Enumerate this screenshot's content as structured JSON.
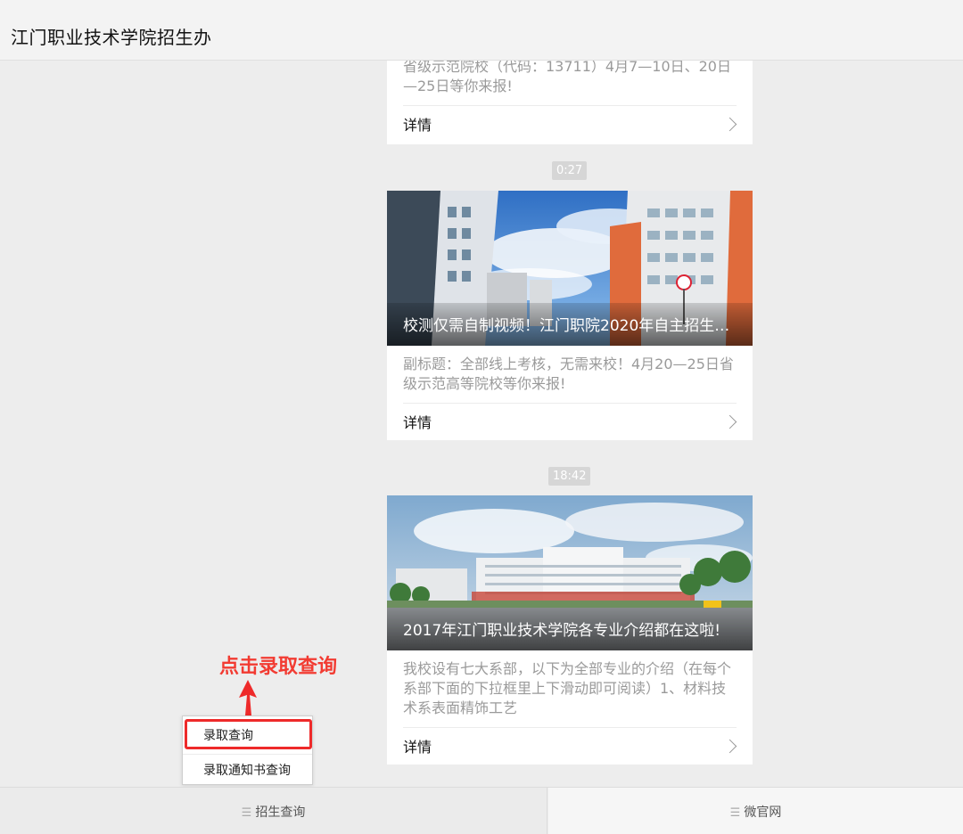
{
  "header": {
    "title": "江门职业技术学院招生办"
  },
  "feed": {
    "card0": {
      "desc": "省级示范院校（代码：13711）4月7—10日、20日—25日等你来报!",
      "detail_label": "详情"
    },
    "time1": "0:27",
    "card1": {
      "title": "校测仅需自制视频！江门职院2020年自主招生（...",
      "desc": "副标题：全部线上考核，无需来校！4月20—25日省级示范高等院校等你来报!",
      "detail_label": "详情"
    },
    "time2": "18:42",
    "card2": {
      "title": "2017年江门职业技术学院各专业介绍都在这啦!",
      "desc": "我校设有七大系部，以下为全部专业的介绍（在每个系部下面的下拉框里上下滑动即可阅读）1、材料技术系表面精饰工艺",
      "detail_label": "详情"
    }
  },
  "annotation": {
    "text": "点击录取查询",
    "color": "#f23b32"
  },
  "popup_menu": {
    "items": [
      "录取查询",
      "录取通知书查询"
    ]
  },
  "bottom_menu": {
    "left": "招生查询",
    "right": "微官网"
  },
  "icons": {
    "menu": "menu-lines-icon",
    "chevron": "chevron-right-icon",
    "arrow": "arrow-up-icon"
  }
}
